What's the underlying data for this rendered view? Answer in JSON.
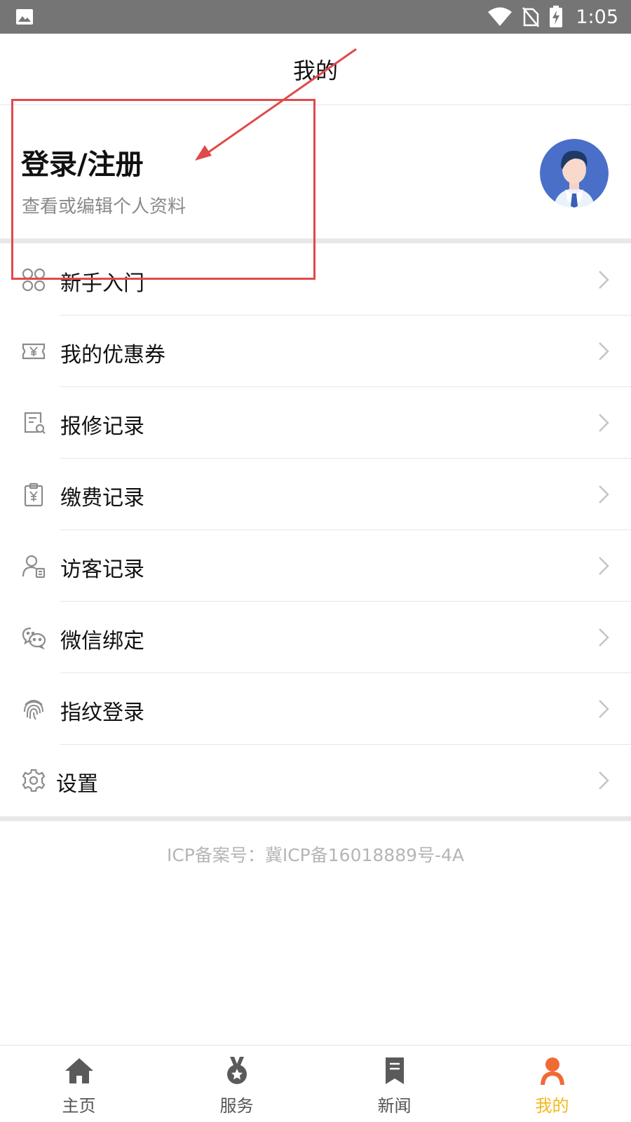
{
  "status_bar": {
    "time": "1:05",
    "icons": [
      "image-icon",
      "wifi-icon",
      "no-sim-icon",
      "battery-charging-icon"
    ]
  },
  "header": {
    "title": "我的"
  },
  "profile": {
    "login_title": "登录/注册",
    "login_subtitle": "查看或编辑个人资料",
    "avatar_icon": "user-avatar-icon"
  },
  "menu": {
    "items": [
      {
        "label": "新手入门",
        "icon": "clover-icon"
      },
      {
        "label": "我的优惠券",
        "icon": "coupon-icon"
      },
      {
        "label": "报修记录",
        "icon": "repair-record-icon"
      },
      {
        "label": "缴费记录",
        "icon": "payment-record-icon"
      },
      {
        "label": "访客记录",
        "icon": "visitor-record-icon"
      },
      {
        "label": "微信绑定",
        "icon": "wechat-icon"
      },
      {
        "label": "指纹登录",
        "icon": "fingerprint-icon"
      },
      {
        "label": "设置",
        "icon": "gear-icon"
      }
    ]
  },
  "footer": {
    "icp": "ICP备案号：冀ICP备16018889号-4A"
  },
  "tabbar": {
    "tabs": [
      {
        "label": "主页",
        "icon": "home-icon",
        "active": false
      },
      {
        "label": "服务",
        "icon": "medal-icon",
        "active": false
      },
      {
        "label": "新闻",
        "icon": "bookmark-icon",
        "active": false
      },
      {
        "label": "我的",
        "icon": "person-icon",
        "active": true
      }
    ]
  },
  "colors": {
    "status_bar": "#757575",
    "accent_active": "#f5b81c",
    "person_tab_icon": "#f06a35",
    "avatar_bg": "#4a6fc9",
    "annotation": "#e04a4a",
    "icon_gray": "#8c8c8c"
  }
}
